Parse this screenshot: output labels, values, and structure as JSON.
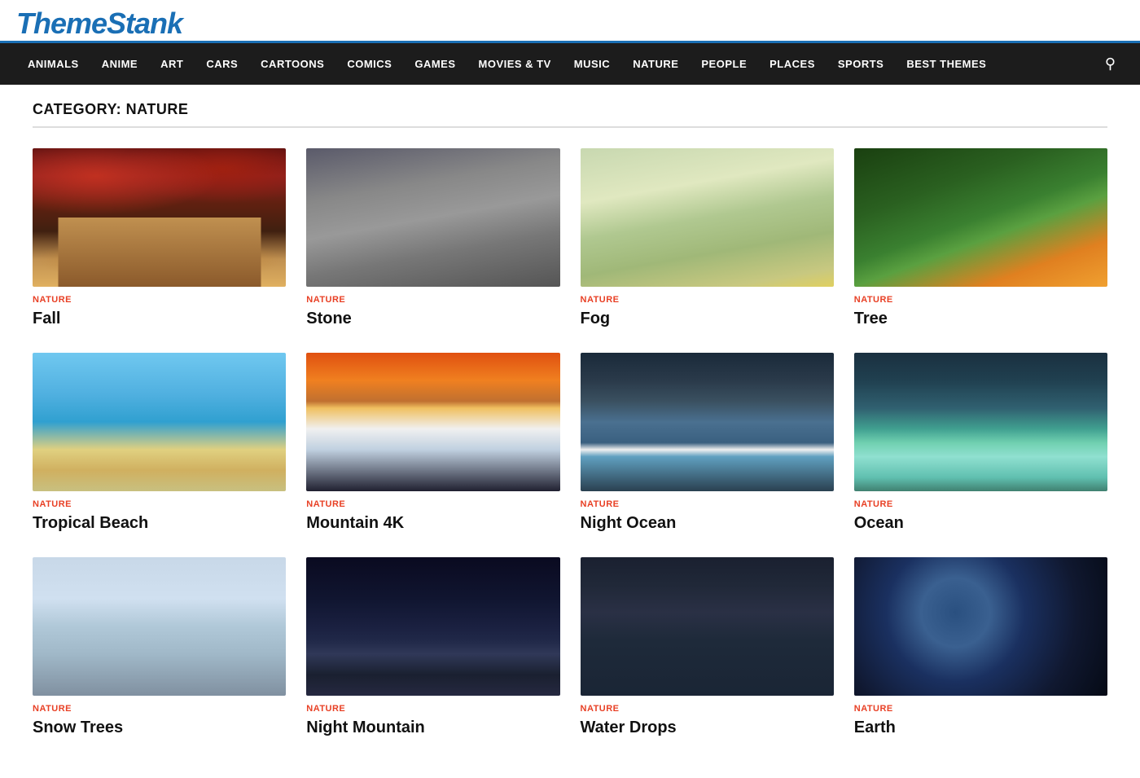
{
  "logo": {
    "text": "ThemeStank"
  },
  "nav": {
    "items": [
      {
        "label": "ANIMALS",
        "id": "animals"
      },
      {
        "label": "ANIME",
        "id": "anime"
      },
      {
        "label": "ART",
        "id": "art"
      },
      {
        "label": "CARS",
        "id": "cars"
      },
      {
        "label": "CARTOONS",
        "id": "cartoons"
      },
      {
        "label": "COMICS",
        "id": "comics"
      },
      {
        "label": "GAMES",
        "id": "games"
      },
      {
        "label": "MOVIES & TV",
        "id": "movies-tv"
      },
      {
        "label": "MUSIC",
        "id": "music"
      },
      {
        "label": "NATURE",
        "id": "nature"
      },
      {
        "label": "PEOPLE",
        "id": "people"
      },
      {
        "label": "PLACES",
        "id": "places"
      },
      {
        "label": "SPORTS",
        "id": "sports"
      },
      {
        "label": "BEST THEMES",
        "id": "best-themes"
      }
    ]
  },
  "category_heading": "CATEGORY: NATURE",
  "cards": [
    {
      "id": "fall",
      "category": "NATURE",
      "title": "Fall",
      "img_class": "img-fall"
    },
    {
      "id": "stone",
      "category": "NATURE",
      "title": "Stone",
      "img_class": "img-stone"
    },
    {
      "id": "fog",
      "category": "NATURE",
      "title": "Fog",
      "img_class": "img-fog"
    },
    {
      "id": "tree",
      "category": "NATURE",
      "title": "Tree",
      "img_class": "img-tree"
    },
    {
      "id": "tropical-beach",
      "category": "NATURE",
      "title": "Tropical Beach",
      "img_class": "img-tropical"
    },
    {
      "id": "mountain-4k",
      "category": "NATURE",
      "title": "Mountain 4K",
      "img_class": "img-mountain"
    },
    {
      "id": "night-ocean",
      "category": "NATURE",
      "title": "Night Ocean",
      "img_class": "img-night-ocean"
    },
    {
      "id": "ocean",
      "category": "NATURE",
      "title": "Ocean",
      "img_class": "img-ocean"
    },
    {
      "id": "snow-trees",
      "category": "NATURE",
      "title": "Snow Trees",
      "img_class": "img-snow-trees"
    },
    {
      "id": "night-mountain",
      "category": "NATURE",
      "title": "Night Mountain",
      "img_class": "img-night-mountain"
    },
    {
      "id": "water-drops",
      "category": "NATURE",
      "title": "Water Drops",
      "img_class": "img-water-drops"
    },
    {
      "id": "earth",
      "category": "NATURE",
      "title": "Earth",
      "img_class": "img-earth"
    }
  ]
}
